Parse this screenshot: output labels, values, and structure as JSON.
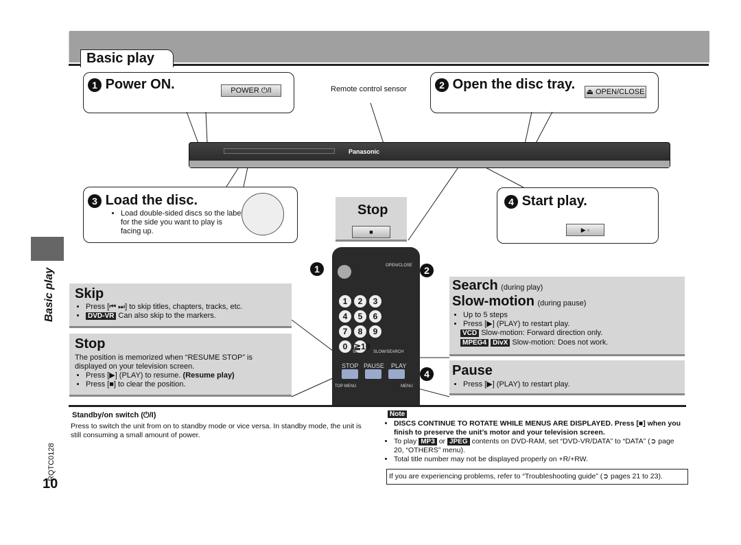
{
  "header": {
    "tab": "Basic play",
    "side_label": "Basic play"
  },
  "step1": {
    "num": "1",
    "title": "Power ON.",
    "button": "POWER ⏻/I"
  },
  "sensor_label": "Remote control sensor",
  "player": {
    "brand": "Panasonic"
  },
  "step2": {
    "num": "2",
    "title": "Open the disc tray.",
    "button": "⏏ OPEN/CLOSE"
  },
  "step3": {
    "num": "3",
    "title": "Load the disc.",
    "bullet": "Load double-sided discs so the label for the side you want to play is facing up."
  },
  "stop_top": {
    "title": "Stop",
    "button": "■"
  },
  "step4": {
    "num": "4",
    "title": "Start play.",
    "button": "▶ ▫"
  },
  "skip": {
    "title": "Skip",
    "bullets": [
      "Press [⏮ ⏭] to skip titles, chapters, tracks, etc."
    ],
    "tag": "DVD-VR",
    "tag_text": "Can also skip to the markers."
  },
  "stop": {
    "title": "Stop",
    "text": "The position is memorized when “RESUME STOP” is displayed on your television screen.",
    "b1": "Press [▶] (PLAY) to resume.",
    "b1_bold": "(Resume play)",
    "b2": "Press [■] to clear the position."
  },
  "search": {
    "title": "Search",
    "title_note": "(during play)",
    "title2": "Slow-motion",
    "title2_note": "(during pause)",
    "bullets": [
      "Up to 5 steps",
      "Press [▶] (PLAY) to restart play."
    ],
    "vcd_tag": "VCD",
    "vcd_text": "Slow-motion: Forward direction only.",
    "mpeg_tag": "MPEG4",
    "divx_tag": "DivX",
    "mpeg_text": "Slow-motion: Does not work."
  },
  "pause": {
    "title": "Pause",
    "bullet": "Press [▶] (PLAY) to restart play."
  },
  "remote": {
    "keys": [
      "1",
      "2",
      "3",
      "4",
      "5",
      "6",
      "7",
      "8",
      "9",
      "0",
      "≧10"
    ],
    "labels": {
      "stop": "STOP",
      "pause": "PAUSE",
      "play": "PLAY",
      "skip": "SKIP",
      "slow": "SLOW/SEARCH",
      "top_menu": "TOP MENU",
      "menu": "MENU",
      "open_close": "OPEN/CLOSE"
    },
    "callouts": [
      "1",
      "2",
      "4"
    ]
  },
  "standby": {
    "title": "Standby/on switch (⏻/I)",
    "text": "Press to switch the unit from on to standby mode or vice versa. In standby mode, the unit is still consuming a small amount of power."
  },
  "note": {
    "label": "Note",
    "b1": "DISCS CONTINUE TO ROTATE WHILE MENUS ARE DISPLAYED. Press [■] when you finish to preserve the unit’s motor and your television screen.",
    "b2_pre": "To play",
    "mp3": "MP3",
    "or": "or",
    "jpeg": "JPEG",
    "b2_post": "contents on DVD-RAM, set “DVD-VR/DATA” to “DATA” (➲ page 20, “OTHERS” menu).",
    "b3": "Total title number may not be displayed properly on +R/+RW.",
    "trouble": "If you are experiencing problems, refer to “Troubleshooting guide” (➲ pages 21 to 23)."
  },
  "footer": {
    "code": "RQTC0128",
    "page": "10"
  }
}
